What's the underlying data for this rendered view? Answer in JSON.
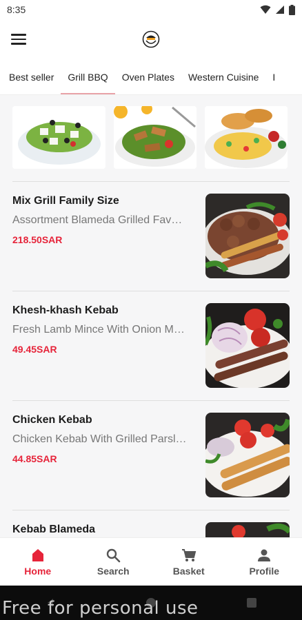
{
  "status_bar": {
    "time": "8:35",
    "icons": [
      "wifi-icon",
      "signal-icon",
      "battery-icon"
    ]
  },
  "app_bar": {
    "menu_icon": "hamburger-menu-icon",
    "logo_icon": "chef-logo-icon"
  },
  "tabs": [
    {
      "label": "Best seller",
      "active": false
    },
    {
      "label": "Grill BBQ",
      "active": true
    },
    {
      "label": "Oven Plates",
      "active": false
    },
    {
      "label": "Western Cuisine",
      "active": false
    },
    {
      "label": "I",
      "active": false
    }
  ],
  "banner": {
    "images": [
      "greek-salad-image",
      "fattoush-salad-image",
      "grilled-platter-image"
    ]
  },
  "menu_items": [
    {
      "name": "Mix Grill Family Size",
      "description": "Assortment Blameda Grilled Fav…",
      "price": "218.50SAR",
      "image": "mix-grill-image"
    },
    {
      "name": "Khesh-khash Kebab",
      "description": "Fresh Lamb Mince With Onion M…",
      "price": "49.45SAR",
      "image": "khesh-khash-kebab-image"
    },
    {
      "name": "Chicken Kebab",
      "description": "Chicken Kebab With Grilled Parsl…",
      "price": "44.85SAR",
      "image": "chicken-kebab-image"
    },
    {
      "name": "Kebab Blameda",
      "description": "",
      "price": "",
      "image": "kebab-blameda-image"
    }
  ],
  "bottom_nav": [
    {
      "label": "Home",
      "icon": "home-icon",
      "active": true
    },
    {
      "label": "Search",
      "icon": "search-icon",
      "active": false
    },
    {
      "label": "Basket",
      "icon": "basket-icon",
      "active": false
    },
    {
      "label": "Profile",
      "icon": "profile-icon",
      "active": false
    }
  ],
  "watermark": "Free for personal use",
  "colors": {
    "accent": "#e6243a",
    "tab_underline": "#e8a3a8",
    "background": "#f6f6f7"
  }
}
